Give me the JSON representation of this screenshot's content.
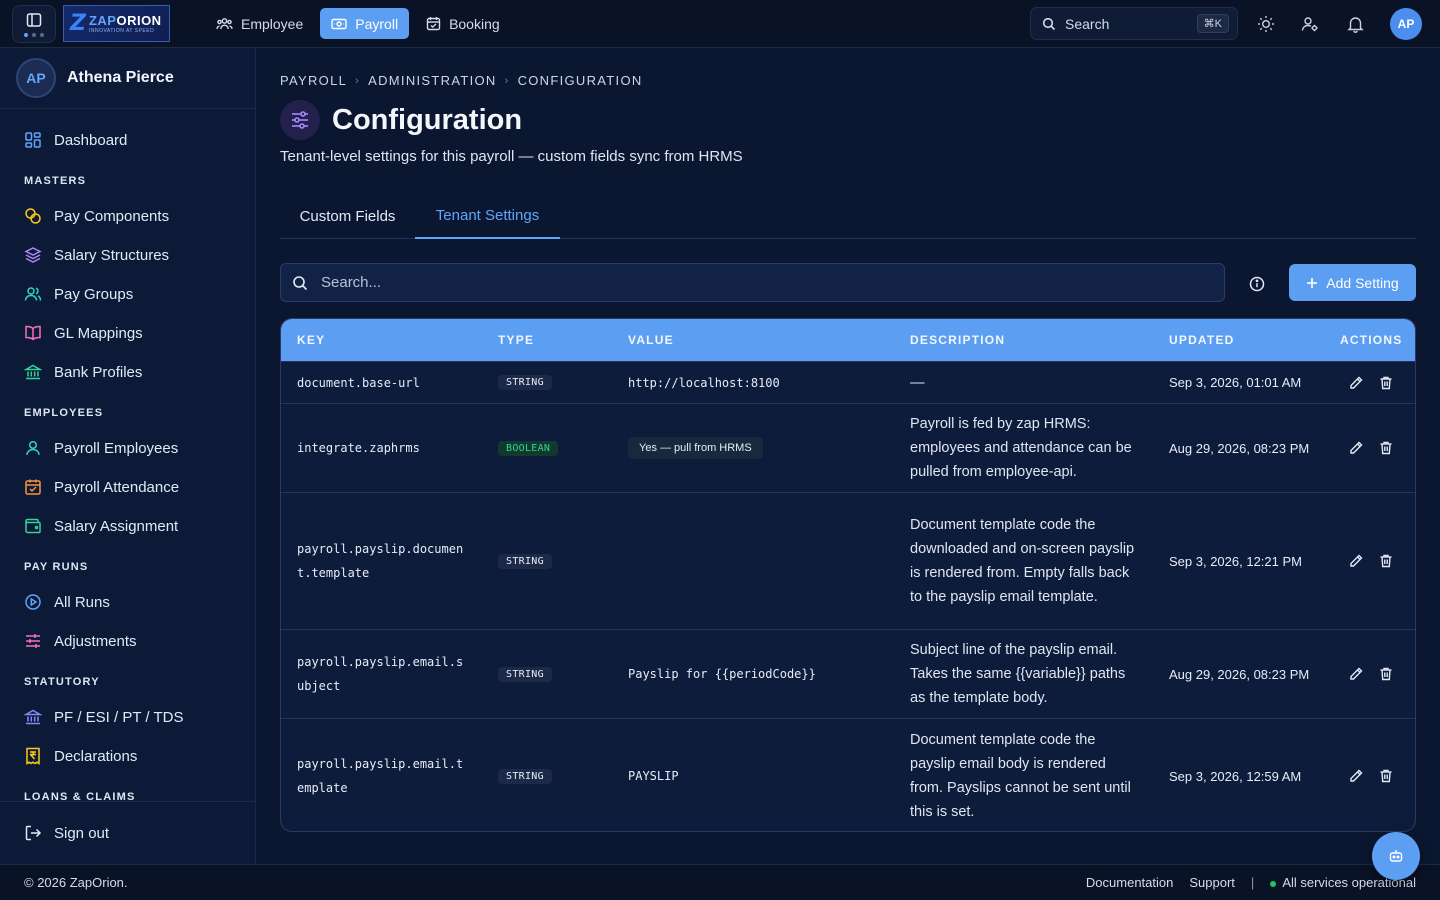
{
  "topbar": {
    "logo_brand_a": "ZAP",
    "logo_brand_b": "ORION",
    "logo_tag": "INNOVATION AT SPEED",
    "nav": [
      {
        "label": "Employee",
        "icon": "users-icon"
      },
      {
        "label": "Payroll",
        "icon": "payroll-icon",
        "active": true
      },
      {
        "label": "Booking",
        "icon": "calendar-check-icon"
      }
    ],
    "search_label": "Search",
    "search_shortcut": "⌘K",
    "avatar_initials": "AP"
  },
  "sidebar": {
    "user_initials": "AP",
    "user_name": "Athena Pierce",
    "dashboard": "Dashboard",
    "sections": {
      "masters": "MASTERS",
      "employees": "EMPLOYEES",
      "pay_runs": "PAY RUNS",
      "statutory": "STATUTORY",
      "loans": "LOANS & CLAIMS"
    },
    "items": {
      "pay_components": "Pay Components",
      "salary_structures": "Salary Structures",
      "pay_groups": "Pay Groups",
      "gl_mappings": "GL Mappings",
      "bank_profiles": "Bank Profiles",
      "payroll_employees": "Payroll Employees",
      "payroll_attendance": "Payroll Attendance",
      "salary_assignment": "Salary Assignment",
      "all_runs": "All Runs",
      "adjustments": "Adjustments",
      "pf_esi": "PF / ESI / PT / TDS",
      "declarations": "Declarations"
    },
    "sign_out": "Sign out"
  },
  "main": {
    "breadcrumb": [
      "PAYROLL",
      "ADMINISTRATION",
      "CONFIGURATION"
    ],
    "title": "Configuration",
    "subtitle": "Tenant-level settings for this payroll — custom fields sync from HRMS",
    "tabs": [
      {
        "label": "Custom Fields",
        "active": false
      },
      {
        "label": "Tenant Settings",
        "active": true
      }
    ],
    "search_placeholder": "Search...",
    "add_button": "Add Setting"
  },
  "table": {
    "columns": [
      "KEY",
      "TYPE",
      "VALUE",
      "DESCRIPTION",
      "UPDATED",
      "ACTIONS"
    ],
    "rows": [
      {
        "key": "document.base-url",
        "type": "STRING",
        "value": "http://localhost:8100",
        "description": "—",
        "updated": "Sep 3, 2026, 01:01 AM"
      },
      {
        "key": "integrate.zaphrms",
        "type": "BOOLEAN",
        "value": "Yes — pull from HRMS",
        "description": "Payroll is fed by zap HRMS: employees and attendance can be pulled from employee-api.",
        "updated": "Aug 29, 2026, 08:23 PM"
      },
      {
        "key": "payroll.payslip.document.template",
        "type": "STRING",
        "value": "",
        "description": "Document template code the downloaded and on-screen payslip is rendered from. Empty falls back to the payslip email template.",
        "updated": "Sep 3, 2026, 12:21 PM"
      },
      {
        "key": "payroll.payslip.email.subject",
        "type": "STRING",
        "value": "Payslip for {{periodCode}}",
        "description": "Subject line of the payslip email. Takes the same {{variable}} paths as the template body.",
        "updated": "Aug 29, 2026, 08:23 PM"
      },
      {
        "key": "payroll.payslip.email.template",
        "type": "STRING",
        "value": "PAYSLIP",
        "description": "Document template code the payslip email body is rendered from. Payslips cannot be sent until this is set.",
        "updated": "Sep 3, 2026, 12:59 AM"
      }
    ]
  },
  "footer": {
    "copyright": "© 2026 ZapOrion.",
    "documentation": "Documentation",
    "support": "Support",
    "separator": "|",
    "status": "All services operational"
  },
  "colors": {
    "accent": "#5b9ef2",
    "bg": "#0b1730",
    "sidebar": "#0c1a38",
    "status_ok": "#22c55e",
    "boolean_badge": "#34d399"
  }
}
